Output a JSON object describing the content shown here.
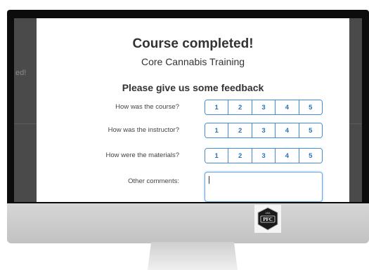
{
  "modal": {
    "title": "Course completed!",
    "subtitle": "Core Cannabis Training",
    "feedback_heading": "Please give us some feedback",
    "questions": [
      {
        "label": "How was the course?",
        "options": [
          "1",
          "2",
          "3",
          "4",
          "5"
        ]
      },
      {
        "label": "How was the instructor?",
        "options": [
          "1",
          "2",
          "3",
          "4",
          "5"
        ]
      },
      {
        "label": "How were the materials?",
        "options": [
          "1",
          "2",
          "3",
          "4",
          "5"
        ]
      }
    ],
    "comments_label": "Other comments:",
    "comments_value": ""
  },
  "background": {
    "partial_text": "ed!"
  },
  "logo": {
    "text": "PFC",
    "small_text": "ASA"
  },
  "colors": {
    "accent": "#3d8bd9",
    "accent_text": "#2a6fb8",
    "bezel": "#0c0c0c"
  }
}
